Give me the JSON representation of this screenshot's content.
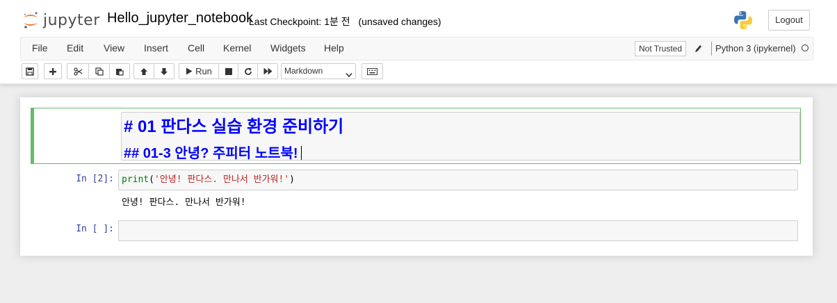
{
  "header": {
    "logo_text": "jupyter",
    "notebook_name": "Hello_jupyter_notebook",
    "checkpoint_label": "Last Checkpoint:",
    "checkpoint_time": "1분 전",
    "unsaved_status": "(unsaved changes)",
    "logout_label": "Logout"
  },
  "menubar": {
    "items": [
      "File",
      "Edit",
      "View",
      "Insert",
      "Cell",
      "Kernel",
      "Widgets",
      "Help"
    ],
    "trust_label": "Not Trusted",
    "kernel_name": "Python 3 (ipykernel)"
  },
  "toolbar": {
    "run_label": "Run",
    "cell_type": "Markdown",
    "icons": [
      "save-icon",
      "plus-icon",
      "cut-icon",
      "copy-icon",
      "paste-icon",
      "arrow-up-icon",
      "arrow-down-icon",
      "play-icon",
      "stop-icon",
      "restart-icon",
      "fast-forward-icon",
      "keyboard-icon"
    ]
  },
  "cells": {
    "markdown": {
      "line1": "# 01 판다스 실습 환경 준비하기",
      "line2": "## 01-3 안녕? 주피터 노트북!"
    },
    "code1": {
      "prompt": "In [2]:",
      "fn": "print",
      "open_paren": "(",
      "string": "'안녕! 판다스. 만나서 반가워!'",
      "close_paren": ")",
      "output": "안녕! 판다스. 만나서 반가워!"
    },
    "code2": {
      "prompt": "In [ ]:"
    }
  },
  "colors": {
    "markdown_heading": "#0000ff",
    "selected_cell_border": "#66bb6a",
    "prompt": "#303f9f",
    "builtin": "#008000",
    "string": "#ba2121"
  }
}
